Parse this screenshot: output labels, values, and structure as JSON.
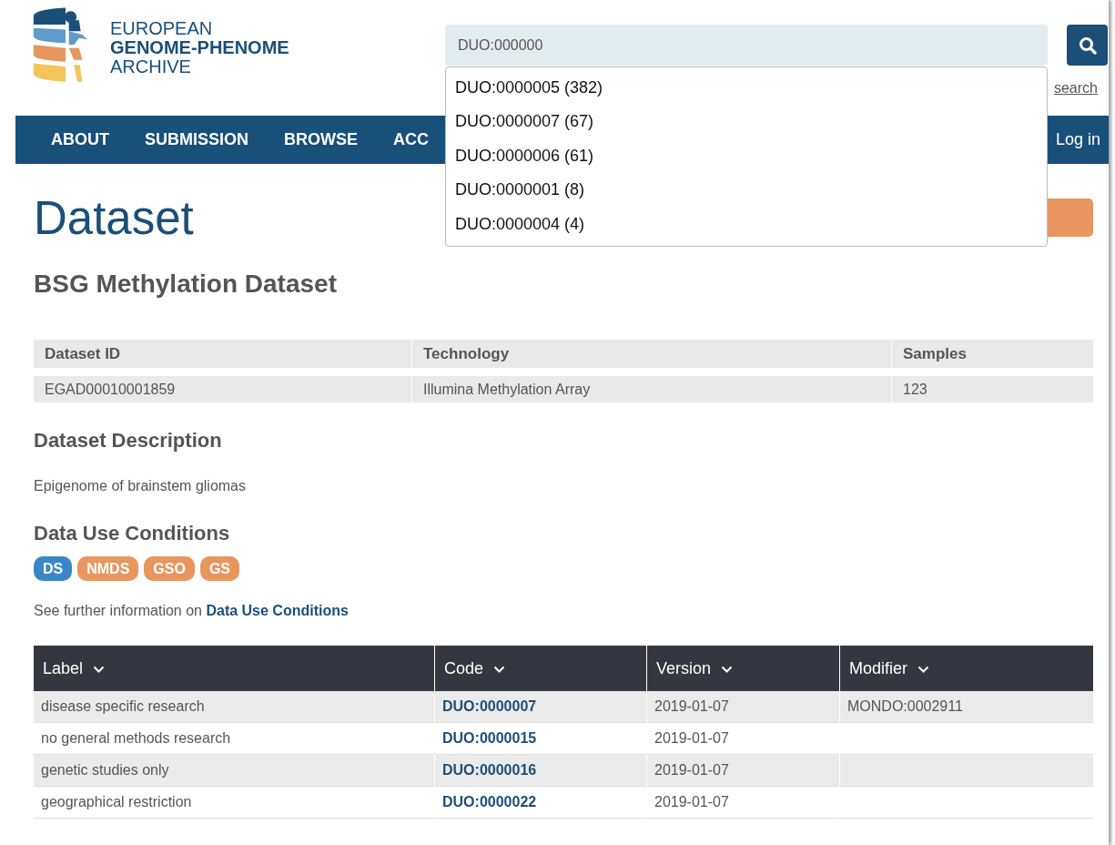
{
  "header": {
    "logo_lines": [
      "EUROPEAN",
      "GENOME-PHENOME",
      "ARCHIVE"
    ],
    "search": {
      "value": "DUO:000000"
    },
    "search_link": "search"
  },
  "nav": {
    "items": [
      {
        "label": "ABOUT"
      },
      {
        "label": "SUBMISSION"
      },
      {
        "label": "BROWSE"
      },
      {
        "label": "ACC"
      }
    ],
    "login": "Log in"
  },
  "autocomplete": [
    "DUO:0000005 (382)",
    "DUO:0000007 (67)",
    "DUO:0000006 (61)",
    "DUO:0000001 (8)",
    "DUO:0000004 (4)"
  ],
  "page_title": "Dataset",
  "dataset_title": "BSG Methylation Dataset",
  "summary_table": {
    "columns": [
      "Dataset ID",
      "Technology",
      "Samples"
    ],
    "row": [
      "EGAD00010001859",
      "Illumina Methylation Array",
      "123"
    ]
  },
  "description": {
    "heading": "Dataset Description",
    "text": "Epigenome of brainstem gliomas"
  },
  "conditions": {
    "heading": "Data Use Conditions",
    "badges": [
      {
        "label": "DS",
        "color": "#3a87c8"
      },
      {
        "label": "NMDS",
        "color": "#e8965f"
      },
      {
        "label": "GSO",
        "color": "#e8965f"
      },
      {
        "label": "GS",
        "color": "#e8965f"
      }
    ],
    "info_text": "See further information on ",
    "info_link": "Data Use Conditions"
  },
  "duo_table": {
    "columns": [
      "Label",
      "Code",
      "Version",
      "Modifier"
    ],
    "rows": [
      [
        "disease specific research",
        "DUO:0000007",
        "2019-01-07",
        "MONDO:0002911"
      ],
      [
        "no general methods research",
        "DUO:0000015",
        "2019-01-07",
        ""
      ],
      [
        "genetic studies only",
        "DUO:0000016",
        "2019-01-07",
        ""
      ],
      [
        "geographical restriction",
        "DUO:0000022",
        "2019-01-07",
        ""
      ]
    ]
  }
}
